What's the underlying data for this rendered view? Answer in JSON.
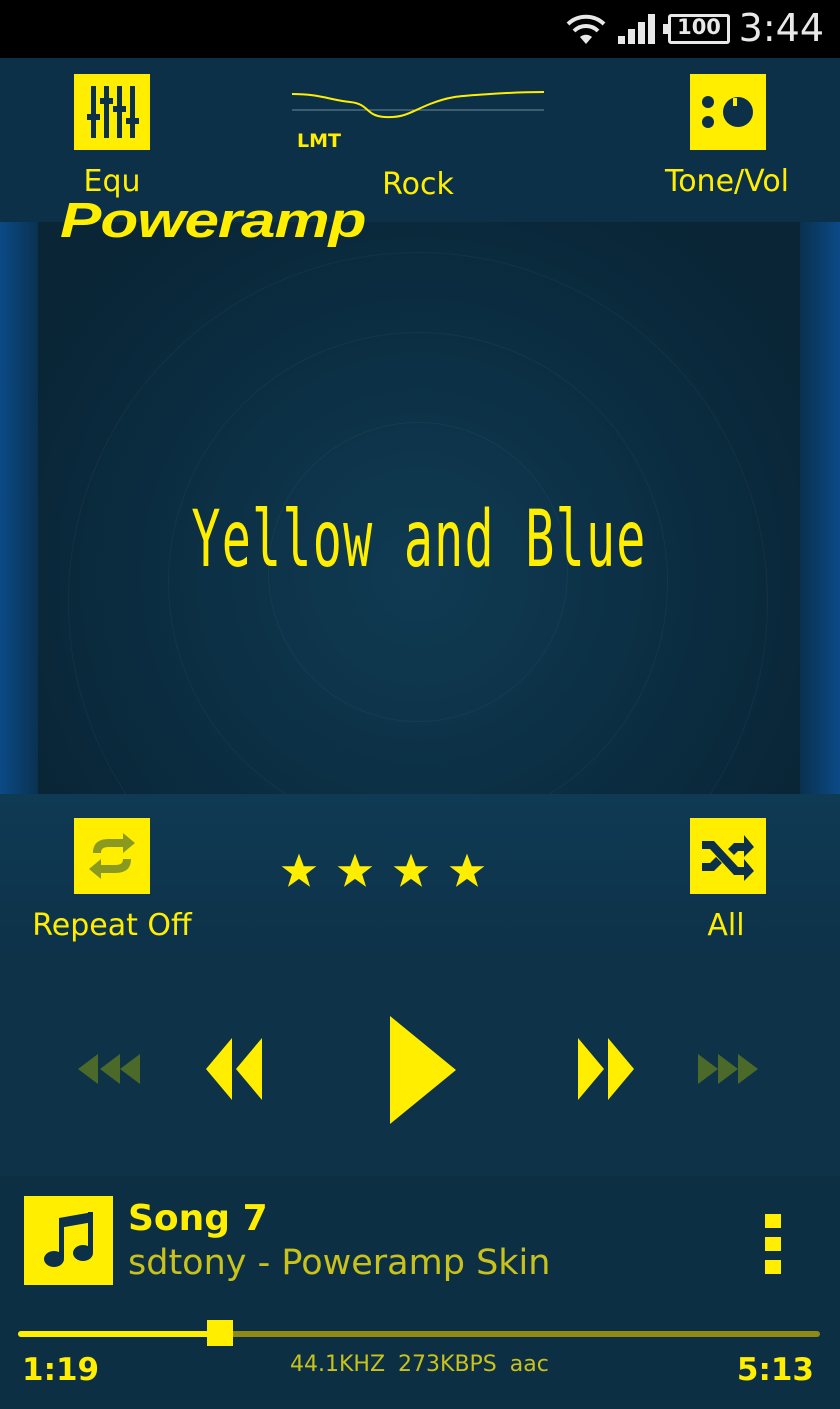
{
  "status_bar": {
    "time": "3:44",
    "battery": "100",
    "icons": [
      "wifi-icon",
      "signal-icon",
      "battery-icon"
    ]
  },
  "top_bar": {
    "equalizer_label": "Equ",
    "limiter_label": "LMT",
    "preset_label": "Rock",
    "tone_volume_label": "Tone/Vol"
  },
  "album_art": {
    "brand": "Poweramp",
    "title": "Yellow and Blue"
  },
  "mid_controls": {
    "repeat_label": "Repeat Off",
    "shuffle_label": "All",
    "rating": 4,
    "rating_max": 4
  },
  "track": {
    "title": "Song 7",
    "artist_album": "sdtony - Poweramp Skin",
    "elapsed": "1:19",
    "duration": "5:13",
    "sample_rate": "44.1KHZ",
    "bitrate": "273KBPS",
    "codec": "aac",
    "progress_fraction": 0.2524
  },
  "colors": {
    "accent": "#ffee00",
    "accent_dim": "#c9c21a",
    "background": "#0d3248",
    "inactive": "#4b6a2a"
  }
}
